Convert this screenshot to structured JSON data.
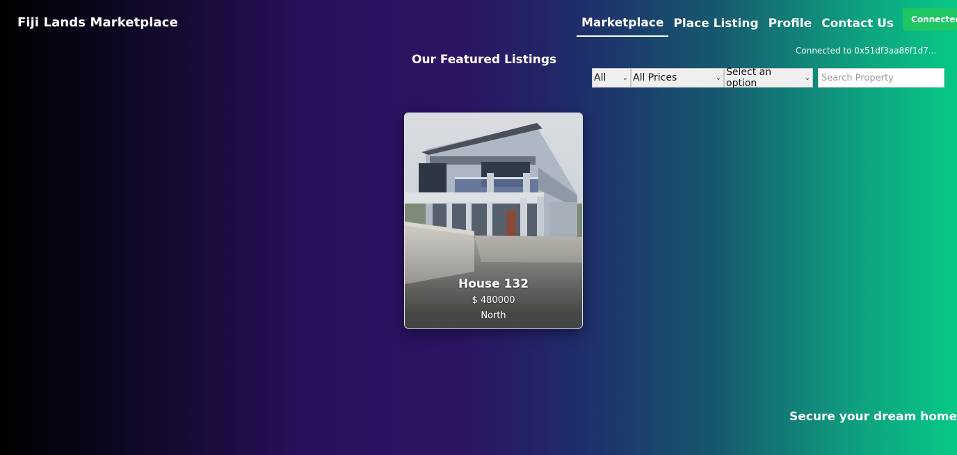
{
  "header": {
    "brand": "Fiji Lands Marketplace",
    "nav": [
      {
        "label": "Marketplace",
        "active": true
      },
      {
        "label": "Place Listing",
        "active": false
      },
      {
        "label": "Profile",
        "active": false
      },
      {
        "label": "Contact Us",
        "active": false
      }
    ],
    "connect_button": "Connected",
    "connected_address": "Connected to 0x51df3aa86f1d7..."
  },
  "main": {
    "section_title": "Our Featured Listings",
    "filters": {
      "type_selected": "All",
      "price_selected": "All Prices",
      "region_selected": "Select an option",
      "search_placeholder": "Search Property"
    },
    "listings": [
      {
        "title": "House 132",
        "price": "$ 480000",
        "region": "North"
      }
    ]
  },
  "footer": {
    "tagline": "Secure your dream home e"
  },
  "colors": {
    "connect_green": "#1fc764",
    "gradient_left": "#000000",
    "gradient_mid": "#2c1463",
    "gradient_right": "#06c886"
  }
}
